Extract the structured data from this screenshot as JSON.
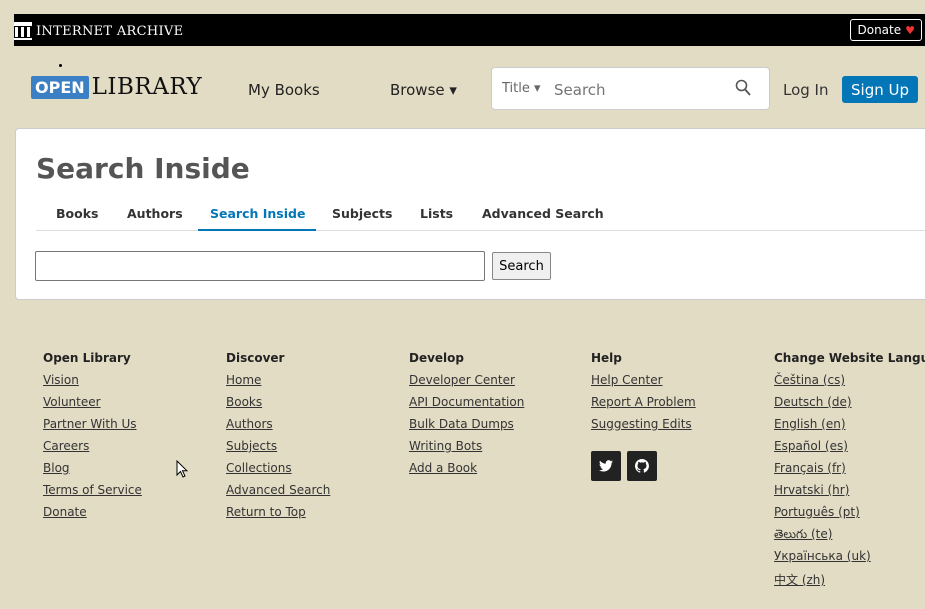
{
  "ia_bar": {
    "title": "INTERNET ARCHIVE",
    "donate_label": "Donate",
    "heart": "♥"
  },
  "header": {
    "logo_open": "OPEN",
    "logo_library": "LIBRARY",
    "my_books": "My Books",
    "browse": "Browse ▾",
    "search_scope": "Title ▾",
    "search_placeholder": "Search",
    "login": "Log In",
    "signup": "Sign Up"
  },
  "main": {
    "title": "Search Inside",
    "tabs": [
      {
        "label": "Books"
      },
      {
        "label": "Authors"
      },
      {
        "label": "Search Inside"
      },
      {
        "label": "Subjects"
      },
      {
        "label": "Lists"
      },
      {
        "label": "Advanced Search"
      }
    ],
    "search_button": "Search"
  },
  "footer": {
    "open_library": {
      "heading": "Open Library",
      "links": [
        "Vision",
        "Volunteer",
        "Partner With Us",
        "Careers",
        "Blog",
        "Terms of Service",
        "Donate"
      ]
    },
    "discover": {
      "heading": "Discover",
      "links": [
        "Home",
        "Books",
        "Authors",
        "Subjects",
        "Collections",
        "Advanced Search",
        "Return to Top"
      ]
    },
    "develop": {
      "heading": "Develop",
      "links": [
        "Developer Center",
        "API Documentation",
        "Bulk Data Dumps",
        "Writing Bots",
        "Add a Book"
      ]
    },
    "help": {
      "heading": "Help",
      "links": [
        "Help Center",
        "Report A Problem",
        "Suggesting Edits"
      ],
      "social_twitter": "twitter-icon",
      "social_github": "github-icon"
    },
    "language": {
      "heading": "Change Website Langua",
      "links": [
        "Čeština (cs)",
        "Deutsch (de)",
        "English (en)",
        "Español (es)",
        "Français (fr)",
        "Hrvatski (hr)",
        "Português (pt)",
        "తెలుగు (te)",
        "Українська (uk)",
        "中文 (zh)"
      ]
    }
  },
  "colors": {
    "background": "#e2dcc5",
    "accent": "#0376b8",
    "logo_blue": "#3b7fc4"
  }
}
